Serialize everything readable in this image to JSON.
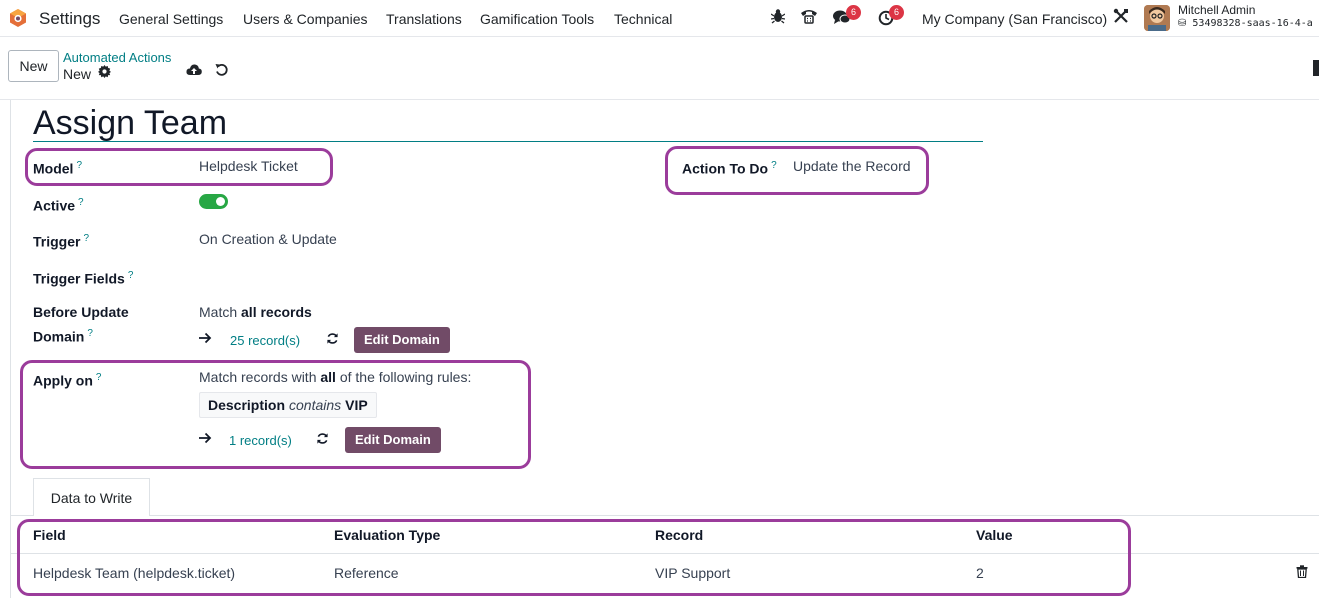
{
  "navbar": {
    "app_name": "Settings",
    "menus": [
      "General Settings",
      "Users & Companies",
      "Translations",
      "Gamification Tools",
      "Technical"
    ],
    "messages_badge": "6",
    "activities_badge": "6",
    "company": "My Company (San Francisco)",
    "user_name": "Mitchell Admin",
    "database": "⛁ 53498328-saas-16-4-a"
  },
  "control_panel": {
    "new_label": "New",
    "breadcrumb_parent": "Automated Actions",
    "breadcrumb_current": "New"
  },
  "form": {
    "title": "Assign Team",
    "model_label": "Model",
    "model_value": "Helpdesk Ticket",
    "action_label": "Action To Do",
    "action_value": "Update the Record",
    "active_label": "Active",
    "active_value": true,
    "trigger_label": "Trigger",
    "trigger_value": "On Creation & Update",
    "trigger_fields_label": "Trigger Fields",
    "before_update_label_1": "Before Update",
    "before_update_label_2": "Domain",
    "before_update_prefix": "Match ",
    "before_update_bold": "all records",
    "before_update_count": "25 record(s)",
    "apply_on_label": "Apply on",
    "apply_on_prefix": "Match records with ",
    "apply_on_bold": "all",
    "apply_on_suffix": " of the following rules:",
    "rule_field": "Description",
    "rule_operator": "contains",
    "rule_value": "VIP",
    "apply_on_count": "1 record(s)",
    "edit_domain_label": "Edit Domain",
    "help_mark": "?"
  },
  "tabs": [
    "Data to Write"
  ],
  "table": {
    "columns": [
      "Field",
      "Evaluation Type",
      "Record",
      "Value"
    ],
    "rows": [
      [
        "Helpdesk Team (helpdesk.ticket)",
        "Reference",
        "VIP Support",
        "2"
      ]
    ]
  },
  "colors": {
    "primary": "#714b67",
    "link": "#017e84",
    "toggle_on": "#28a745",
    "highlight": "#9b3c9b",
    "badge": "#dc3545"
  },
  "icons": [
    "odoo-logo-icon",
    "bug-icon",
    "phone-icon",
    "chat-icon",
    "clock-icon",
    "tools-icon",
    "avatar",
    "gear-icon",
    "cloud-upload-icon",
    "undo-icon",
    "arrow-right-icon",
    "refresh-icon",
    "trash-icon"
  ]
}
